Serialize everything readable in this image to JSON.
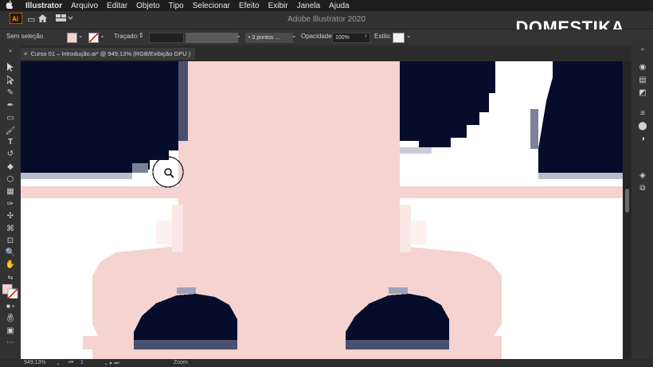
{
  "menubar": {
    "apple_icon": "apple-icon",
    "items": [
      "Illustrator",
      "Arquivo",
      "Editar",
      "Objeto",
      "Tipo",
      "Selecionar",
      "Efeito",
      "Exibir",
      "Janela",
      "Ajuda"
    ]
  },
  "appbar": {
    "title": "Adobe Illustrator 2020"
  },
  "brand": {
    "logo_text": "DOMESTIKA"
  },
  "control_bar": {
    "selection_label": "Sem seleção",
    "stroke_label": "Traçado:",
    "brush_value": "3 pontos ...",
    "opacity_label": "Opacidade:",
    "opacity_value": "100%",
    "style_label": "Estilo:"
  },
  "document_tab": {
    "close_glyph": "×",
    "title": "Curso 01 – Introdução.ai* @ 949,13% (RGB/Exibição GPU )"
  },
  "status_bar": {
    "zoom_value": "949,13%",
    "artboard_number": "1",
    "tool_label": "Zoom"
  },
  "colors": {
    "navy": "#050d2b",
    "pink": "#f5d3d0",
    "white": "#ffffff",
    "ui_dark": "#323232"
  }
}
